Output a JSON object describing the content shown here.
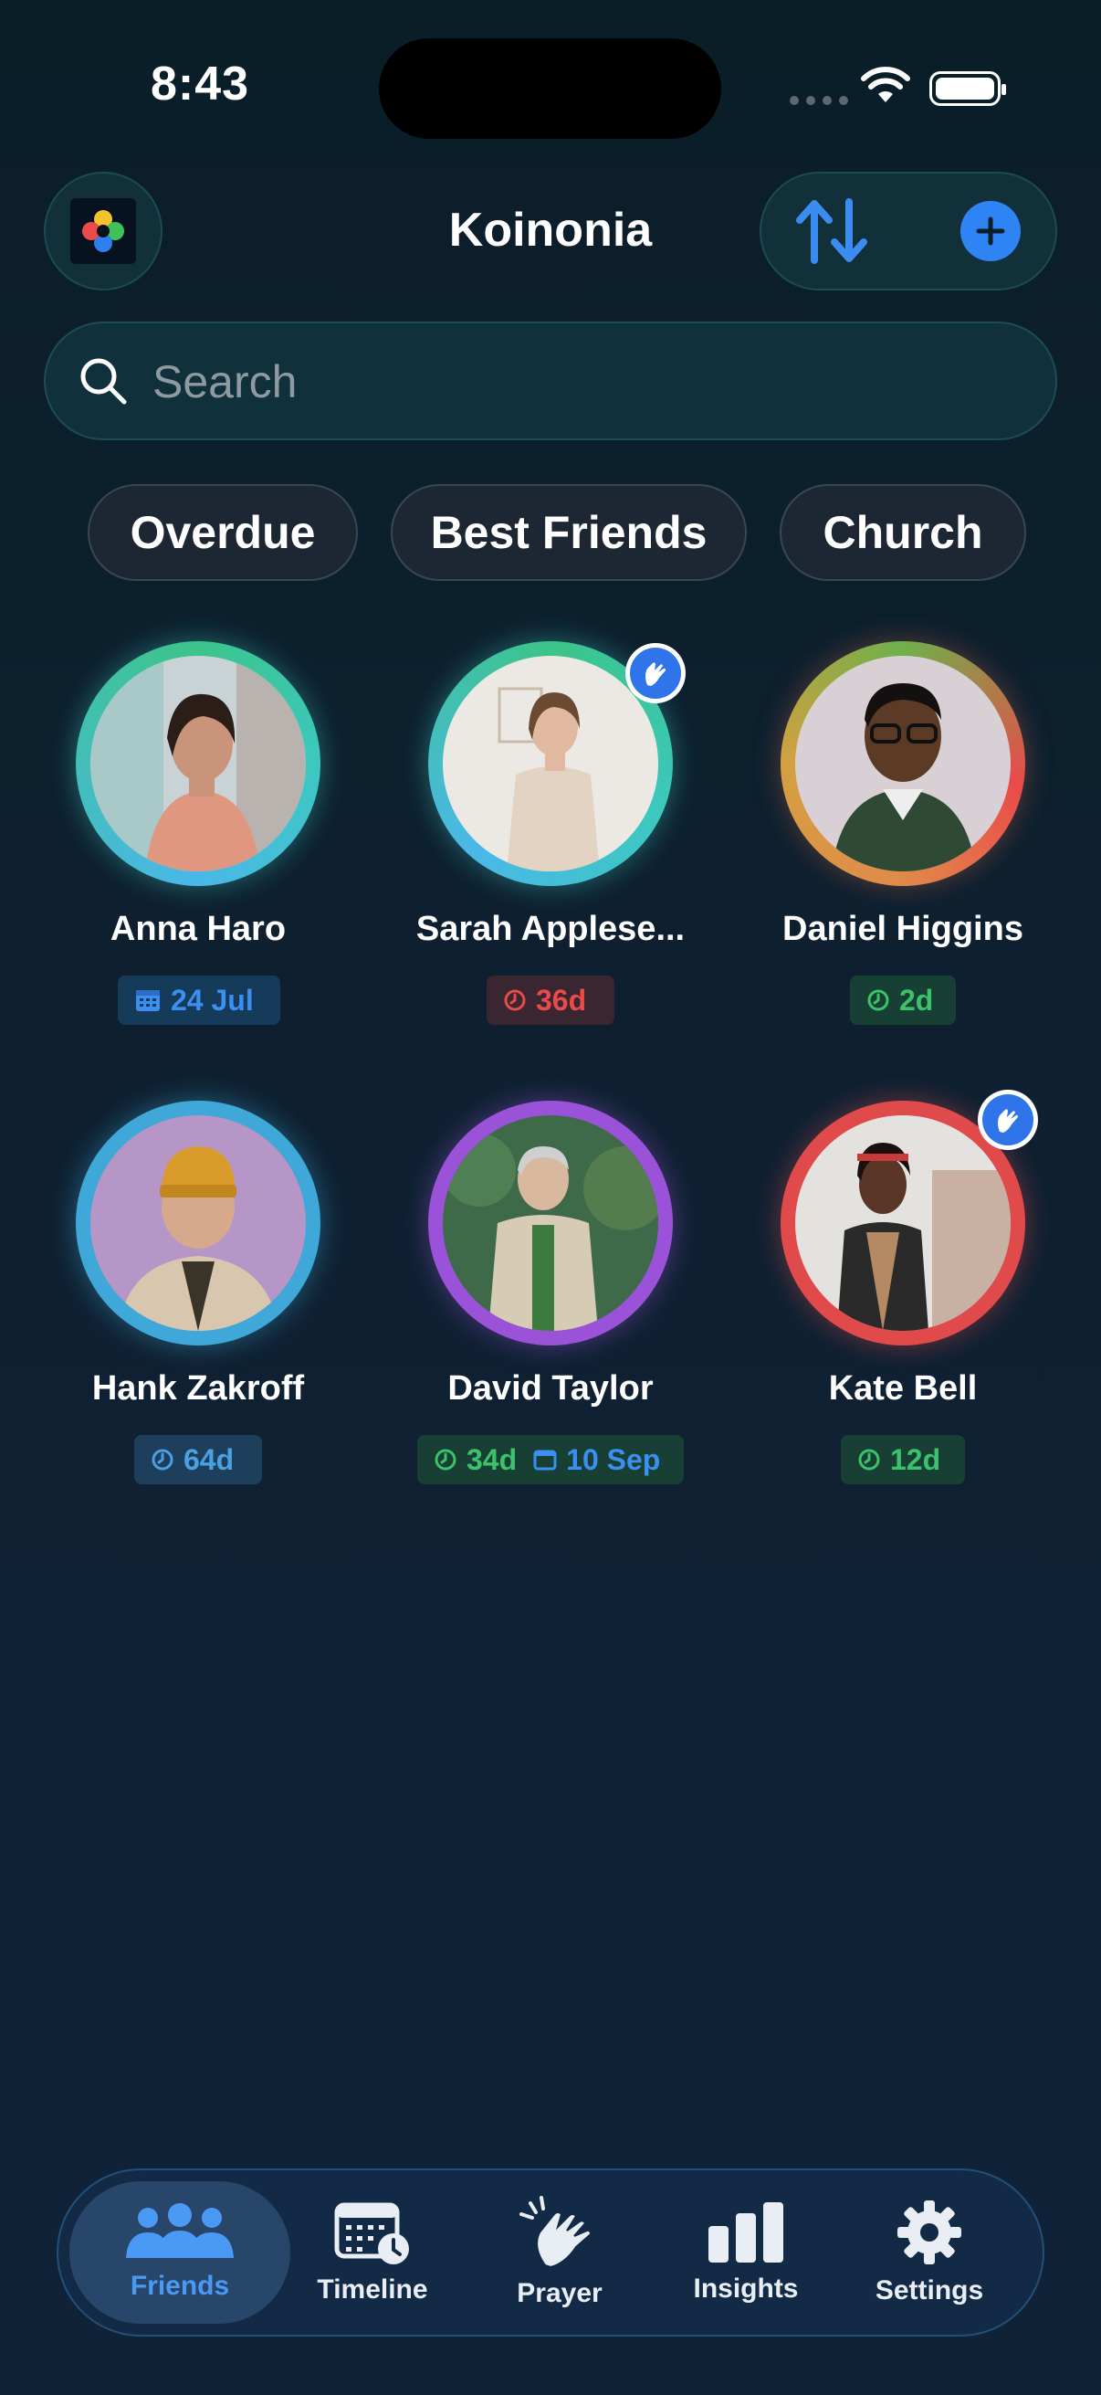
{
  "status_bar": {
    "time": "8:43"
  },
  "header": {
    "title": "Koinonia"
  },
  "search": {
    "placeholder": "Search"
  },
  "filters": [
    "Overdue",
    "Best Friends",
    "Church"
  ],
  "friends": [
    {
      "name": "Anna Haro",
      "badge_date": "24 Jul"
    },
    {
      "name": "Sarah Applese...",
      "badge_overdue": "36d"
    },
    {
      "name": "Daniel Higgins",
      "badge_days": "2d"
    },
    {
      "name": "Hank Zakroff",
      "badge_days": "64d"
    },
    {
      "name": "David Taylor",
      "badge_days": "34d",
      "badge_date": "10 Sep"
    },
    {
      "name": "Kate Bell",
      "badge_days": "12d"
    }
  ],
  "tabs": [
    "Friends",
    "Timeline",
    "Prayer",
    "Insights",
    "Settings"
  ],
  "colors": {
    "accent": "#2f84f5",
    "green": "#3cc26a",
    "red": "#e94a4a",
    "teal": "#3cc8c0",
    "purple": "#9a52d8"
  }
}
